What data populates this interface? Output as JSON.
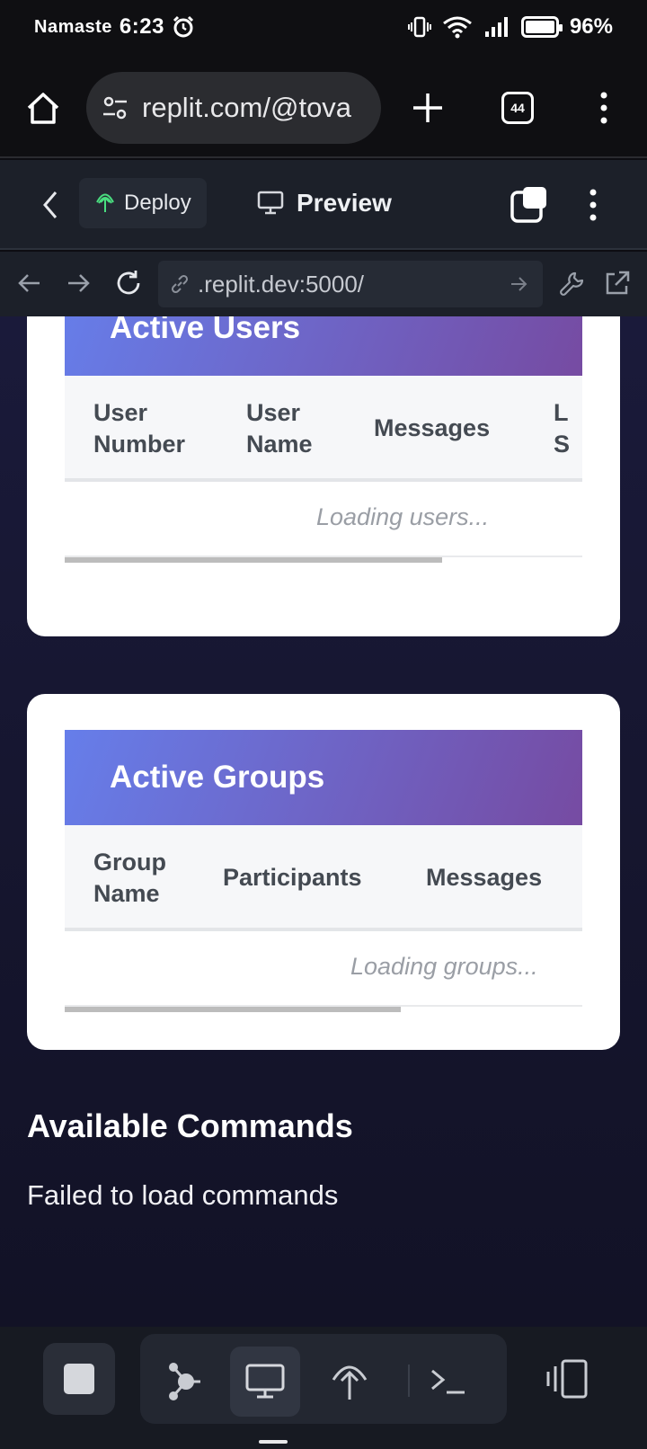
{
  "status_bar": {
    "carrier": "Namaste",
    "time": "6:23",
    "battery": "96%"
  },
  "browser": {
    "url": "replit.com/@tova",
    "tab_count": "44"
  },
  "replit_toolbar": {
    "deploy_label": "Deploy",
    "preview_label": "Preview"
  },
  "webview": {
    "address": ".replit.dev:5000/"
  },
  "users_card": {
    "title": "Active Users",
    "columns": [
      "User\nNumber",
      "User\nName",
      "Messages",
      "L\nS"
    ],
    "loading_text": "Loading users...",
    "scroll_fraction": 0.73
  },
  "groups_card": {
    "title": "Active Groups",
    "columns": [
      "Group\nName",
      "Participants",
      "Messages"
    ],
    "loading_text": "Loading groups...",
    "scroll_fraction": 0.65
  },
  "commands": {
    "title": "Available Commands",
    "message": "Failed to load commands"
  },
  "colors": {
    "header_gradient_start": "#667eea",
    "header_gradient_end": "#764ba2",
    "deploy_icon": "#4ade80"
  }
}
